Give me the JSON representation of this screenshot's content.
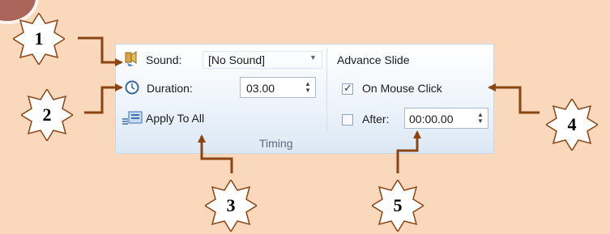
{
  "timing": {
    "sound_label": "Sound:",
    "sound_value": "[No Sound]",
    "duration_label": "Duration:",
    "duration_value": "03.00",
    "apply_label": "Apply To All",
    "group_label": "Timing"
  },
  "advance": {
    "title": "Advance Slide",
    "mouse_click_label": "On Mouse Click",
    "mouse_click_checked": true,
    "after_label": "After:",
    "after_checked": false,
    "after_value": "00:00.00"
  },
  "callouts": [
    "1",
    "2",
    "3",
    "4",
    "5"
  ],
  "colors": {
    "background": "#f9d8bc",
    "arrow": "#8b4513",
    "panel": "#eef4fb"
  }
}
